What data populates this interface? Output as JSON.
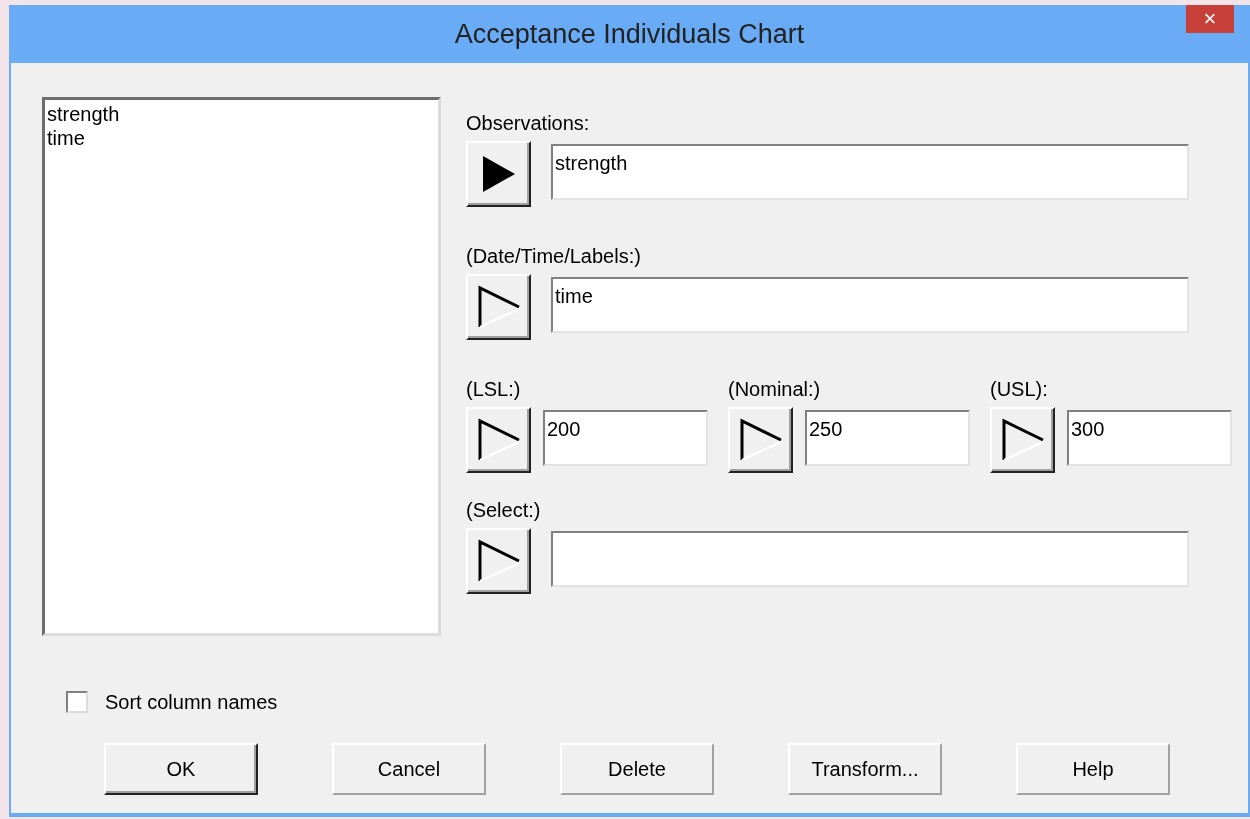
{
  "window": {
    "title": "Acceptance Individuals Chart",
    "close_glyph": "×"
  },
  "variables": [
    "strength",
    "time"
  ],
  "field_rows": [
    [
      {
        "label": "Observations:",
        "value": "strength",
        "kind": "filled"
      }
    ],
    [
      {
        "label": "(Date/Time/Labels:)",
        "value": "time",
        "kind": "outline"
      }
    ],
    [
      {
        "label": "(LSL:)",
        "value": "200",
        "kind": "outline"
      },
      {
        "label": "(Nominal:)",
        "value": "250",
        "kind": "outline"
      },
      {
        "label": "(USL):",
        "value": "300",
        "kind": "outline"
      }
    ],
    [
      {
        "label": "(Select:)",
        "kind": "outline"
      }
    ]
  ],
  "sort_column_names": {
    "label": "Sort column names",
    "checked": false
  },
  "buttons": [
    {
      "label": "OK",
      "default": true
    },
    {
      "label": "Cancel",
      "default": false
    },
    {
      "label": "Delete",
      "default": false
    },
    {
      "label": "Transform...",
      "default": false
    },
    {
      "label": "Help",
      "default": false
    }
  ]
}
